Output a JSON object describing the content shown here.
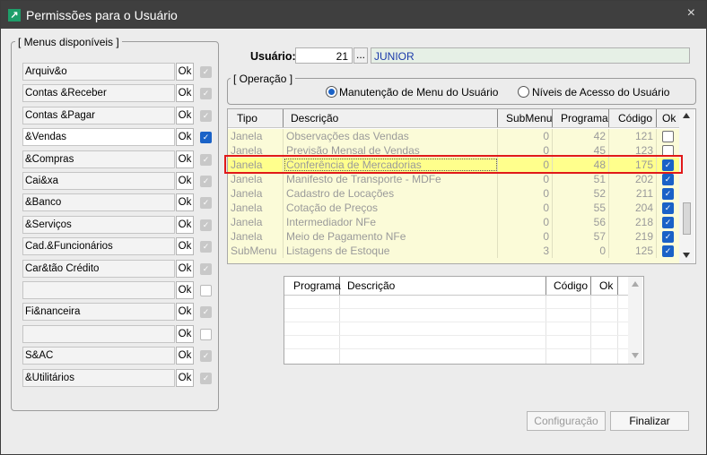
{
  "window": {
    "title": "Permissões para o Usuário",
    "close_glyph": "×"
  },
  "menus": {
    "legend": "[  Menus disponíveis  ]",
    "ok_label": "Ok",
    "items": [
      {
        "label": "Arquiv&o",
        "checked": "gray"
      },
      {
        "label": "Contas &Receber",
        "checked": "gray"
      },
      {
        "label": "Contas &Pagar",
        "checked": "gray"
      },
      {
        "label": "&Vendas",
        "checked": "blue",
        "active": true
      },
      {
        "label": "&Compras",
        "checked": "gray"
      },
      {
        "label": "Cai&xa",
        "checked": "gray"
      },
      {
        "label": "&Banco",
        "checked": "gray"
      },
      {
        "label": "&Serviços",
        "checked": "gray"
      },
      {
        "label": "Cad.&Funcionários",
        "checked": "gray"
      },
      {
        "label": "Car&tão Crédito",
        "checked": "gray"
      },
      {
        "label": "",
        "checked": "none"
      },
      {
        "label": "Fi&nanceira",
        "checked": "gray"
      },
      {
        "label": "",
        "checked": "none"
      },
      {
        "label": "S&AC",
        "checked": "gray"
      },
      {
        "label": "&Utilitários",
        "checked": "gray"
      }
    ]
  },
  "usuario": {
    "label": "Usuário:",
    "code": "21",
    "browse": "...",
    "name": "JUNIOR"
  },
  "operacao": {
    "legend": "[  Operação  ]",
    "option1": "Manutenção de Menu do Usuário",
    "option2": "Níveis de Acesso do Usuário"
  },
  "grid": {
    "headers": {
      "tipo": "Tipo",
      "descricao": "Descrição",
      "submenu": "SubMenu",
      "programa": "Programa",
      "codigo": "Código",
      "ok": "Ok"
    },
    "rows": [
      {
        "tipo": "Janela",
        "descricao": "Observações das Vendas",
        "submenu": "0",
        "programa": "42",
        "codigo": "121",
        "ok": "partial"
      },
      {
        "tipo": "Janela",
        "descricao": "Previsão Mensal de Vendas",
        "submenu": "0",
        "programa": "45",
        "codigo": "123",
        "ok": "unchecked"
      },
      {
        "tipo": "Janela",
        "descricao": "Conferência de Mercadorias",
        "submenu": "0",
        "programa": "48",
        "codigo": "175",
        "ok": "checked",
        "selected": true
      },
      {
        "tipo": "Janela",
        "descricao": "Manifesto de Transporte - MDFe",
        "submenu": "0",
        "programa": "51",
        "codigo": "202",
        "ok": "checked"
      },
      {
        "tipo": "Janela",
        "descricao": "Cadastro de Locações",
        "submenu": "0",
        "programa": "52",
        "codigo": "211",
        "ok": "checked"
      },
      {
        "tipo": "Janela",
        "descricao": "Cotação de Preços",
        "submenu": "0",
        "programa": "55",
        "codigo": "204",
        "ok": "checked"
      },
      {
        "tipo": "Janela",
        "descricao": "Intermediador NFe",
        "submenu": "0",
        "programa": "56",
        "codigo": "218",
        "ok": "checked"
      },
      {
        "tipo": "Janela",
        "descricao": "Meio de Pagamento NFe",
        "submenu": "0",
        "programa": "57",
        "codigo": "219",
        "ok": "checked"
      },
      {
        "tipo": "SubMenu",
        "descricao": "Listagens de Estoque",
        "submenu": "3",
        "programa": "0",
        "codigo": "125",
        "ok": "checked"
      }
    ]
  },
  "subgrid": {
    "headers": {
      "programa": "Programa",
      "descricao": "Descrição",
      "codigo": "Código",
      "ok": "Ok"
    }
  },
  "buttons": {
    "configuracao": "Configuração",
    "finalizar": "Finalizar"
  },
  "colors": {
    "selection_outline": "#e11919",
    "check_blue": "#1a62c7",
    "row_bg": "#fbfbd8",
    "titlebar": "#3f3f3f"
  }
}
